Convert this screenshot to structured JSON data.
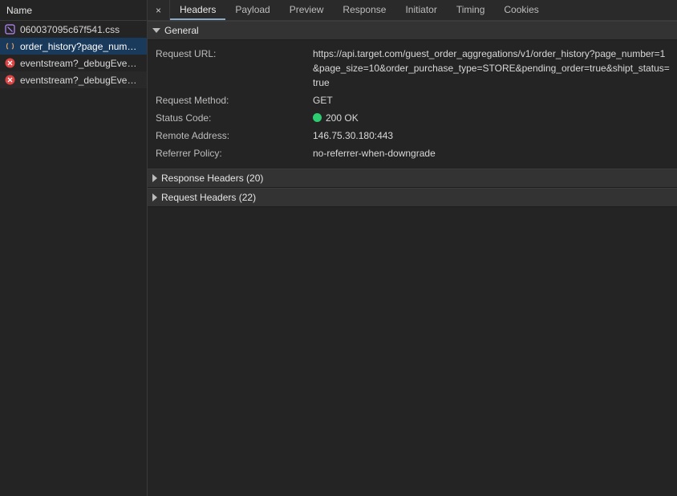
{
  "leftHeader": "Name",
  "requests": [
    {
      "label": "060037095c67f541.css",
      "iconColor": "#b78cff",
      "iconKind": "css"
    },
    {
      "label": "order_history?page_numbe…",
      "iconColor": "#e0a060",
      "iconKind": "xhr"
    },
    {
      "label": "eventstream?_debugEvent=…",
      "iconColor": "#d44",
      "iconKind": "error"
    },
    {
      "label": "eventstream?_debugEvent=…",
      "iconColor": "#d44",
      "iconKind": "error"
    }
  ],
  "selectedRequestIndex": 1,
  "closeGlyph": "×",
  "tabs": [
    "Headers",
    "Payload",
    "Preview",
    "Response",
    "Initiator",
    "Timing",
    "Cookies"
  ],
  "activeTabIndex": 0,
  "sections": {
    "general": {
      "title": "General",
      "rows": {
        "url_k": "Request URL:",
        "url_v": "https://api.target.com/guest_order_aggregations/v1/order_history?page_number=1&page_size=10&order_purchase_type=STORE&pending_order=true&shipt_status=true",
        "method_k": "Request Method:",
        "method_v": "GET",
        "status_k": "Status Code:",
        "status_v": "200 OK",
        "remote_k": "Remote Address:",
        "remote_v": "146.75.30.180:443",
        "ref_k": "Referrer Policy:",
        "ref_v": "no-referrer-when-downgrade"
      }
    },
    "responseHeaders": {
      "title": "Response Headers (20)"
    },
    "requestHeaders": {
      "title": "Request Headers (22)"
    }
  }
}
